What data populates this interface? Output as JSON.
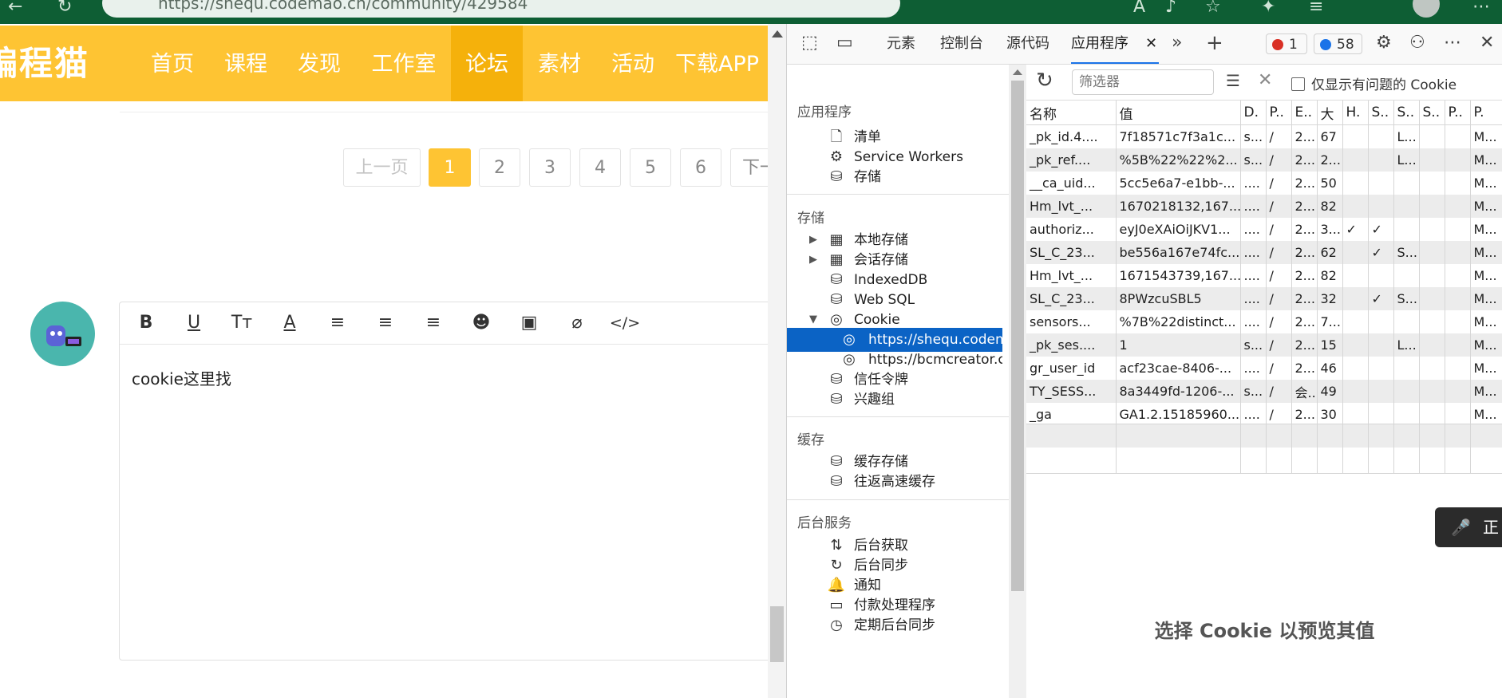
{
  "browser": {
    "url": "https://shequ.codemao.cn/community/429584"
  },
  "site": {
    "logo": "编程猫",
    "nav": [
      "首页",
      "课程",
      "发现",
      "工作室",
      "论坛",
      "素材",
      "活动",
      "下载APP"
    ],
    "active_nav": "论坛",
    "pagination": [
      "上一页",
      "1",
      "2",
      "3",
      "4",
      "5",
      "6",
      "下一"
    ],
    "editor_text": "cookie这里找"
  },
  "devtools": {
    "tabs": [
      "元素",
      "控制台",
      "源代码",
      "应用程序"
    ],
    "active_tab": "应用程序",
    "error_count": "1",
    "message_count": "58",
    "sidebar": {
      "app_title": "应用程序",
      "app_items": [
        "清单",
        "Service Workers",
        "存储"
      ],
      "storage_title": "存储",
      "storage_items": [
        "本地存储",
        "会话存储",
        "IndexedDB",
        "Web SQL",
        "Cookie"
      ],
      "cookie_origins": [
        "https://shequ.codemao.cn",
        "https://bcmcreator.cn"
      ],
      "storage_items_2": [
        "信任令牌",
        "兴趣组"
      ],
      "cache_title": "缓存",
      "cache_items": [
        "缓存存储",
        "往返高速缓存"
      ],
      "bg_title": "后台服务",
      "bg_items": [
        "后台获取",
        "后台同步",
        "通知",
        "付款处理程序",
        "定期后台同步"
      ]
    },
    "cookies": {
      "filter_placeholder": "筛选器",
      "only_issues_label": "仅显示有问题的 Cookie",
      "columns": [
        "名称",
        "值",
        "D.",
        "P..",
        "E..",
        "大",
        "H.",
        "S..",
        "S..",
        "S..",
        "P..",
        "P."
      ],
      "rows": [
        [
          "_pk_id.4....",
          "7f18571c7f3a1c...",
          "s...",
          "/",
          "2...",
          "67",
          "",
          "",
          "L...",
          "",
          "",
          "M..."
        ],
        [
          "_pk_ref....",
          "%5B%22%22%2...",
          "s...",
          "/",
          "2...",
          "2...",
          "",
          "",
          "L...",
          "",
          "",
          "M..."
        ],
        [
          "__ca_uid...",
          "5cc5e6a7-e1bb-...",
          "....",
          "/",
          "2...",
          "50",
          "",
          "",
          "",
          "",
          "",
          "M..."
        ],
        [
          "Hm_lvt_...",
          "1670218132,167...",
          "....",
          "/",
          "2...",
          "82",
          "",
          "",
          "",
          "",
          "",
          "M..."
        ],
        [
          "authoriz...",
          "eyJ0eXAiOiJKV1...",
          "....",
          "/",
          "2...",
          "3...",
          "✓",
          "✓",
          "",
          "",
          "",
          "M..."
        ],
        [
          "SL_C_23...",
          "be556a167e74fc...",
          "....",
          "/",
          "2...",
          "62",
          "",
          "✓",
          "S...",
          "",
          "",
          "M..."
        ],
        [
          "Hm_lvt_...",
          "1671543739,167...",
          "....",
          "/",
          "2...",
          "82",
          "",
          "",
          "",
          "",
          "",
          "M..."
        ],
        [
          "SL_C_23...",
          "8PWzcuSBL5",
          "....",
          "/",
          "2...",
          "32",
          "",
          "✓",
          "S...",
          "",
          "",
          "M..."
        ],
        [
          "sensors...",
          "%7B%22distinct...",
          "....",
          "/",
          "2...",
          "7...",
          "",
          "",
          "",
          "",
          "",
          "M..."
        ],
        [
          "_pk_ses....",
          "1",
          "s...",
          "/",
          "2...",
          "15",
          "",
          "",
          "L...",
          "",
          "",
          "M..."
        ],
        [
          "gr_user_id",
          "acf23cae-8406-...",
          "....",
          "/",
          "2...",
          "46",
          "",
          "",
          "",
          "",
          "",
          "M..."
        ],
        [
          "TY_SESS...",
          "8a3449fd-1206-...",
          "s...",
          "/",
          "会...",
          "49",
          "",
          "",
          "",
          "",
          "",
          "M..."
        ],
        [
          "_ga",
          "GA1.2.15185960...",
          "....",
          "/",
          "2...",
          "30",
          "",
          "",
          "",
          "",
          "",
          "M..."
        ]
      ],
      "preview_hint": "选择 Cookie 以预览其值"
    },
    "toast_text": "正"
  },
  "colors": {
    "nav_bg": "#fec433",
    "nav_active": "#f5b10b",
    "selection": "#0b63c5"
  }
}
